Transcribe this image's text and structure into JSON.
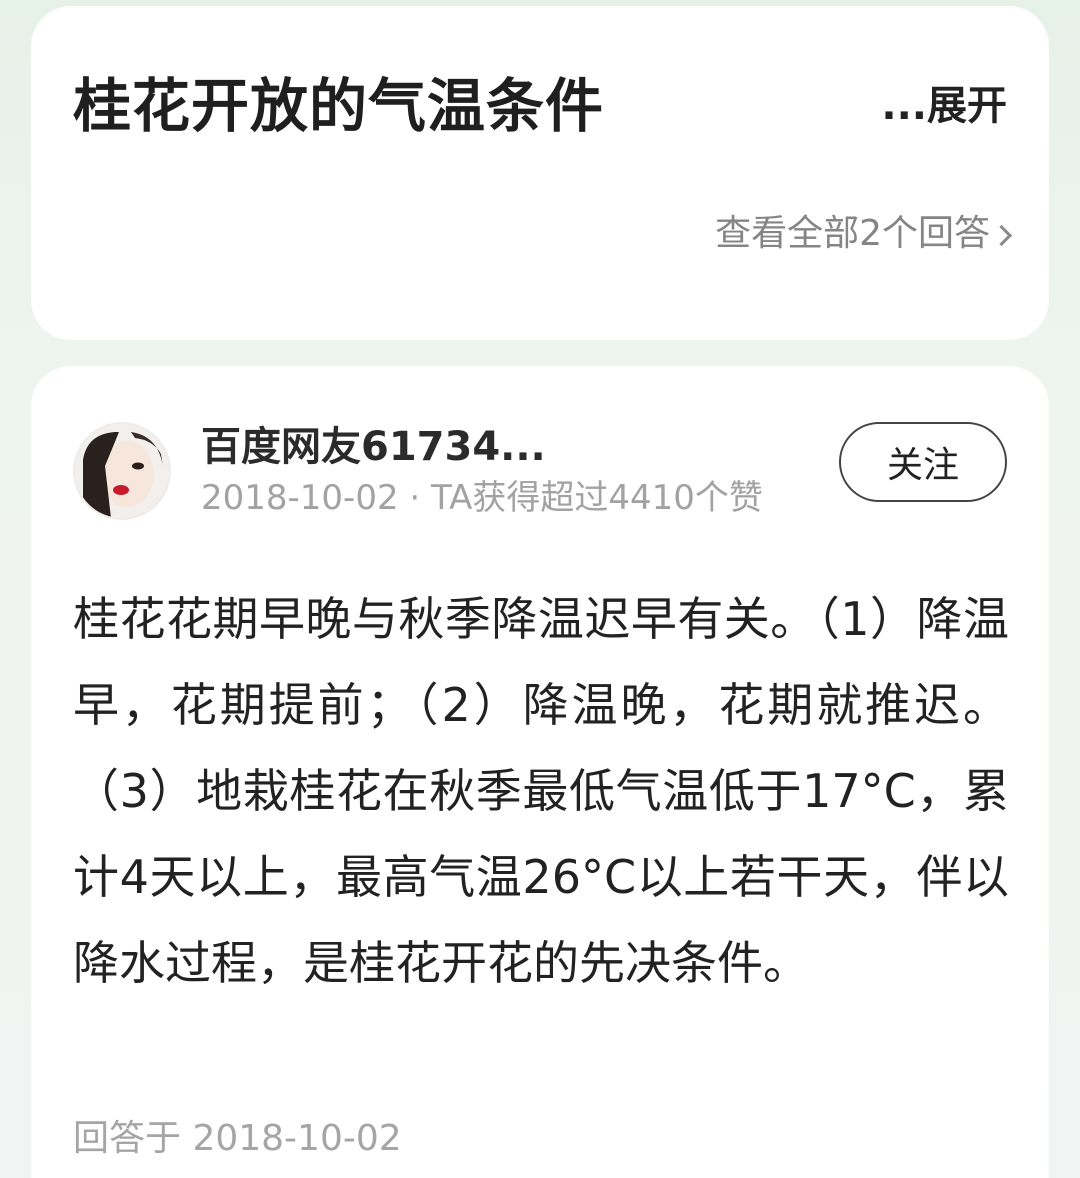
{
  "question": {
    "title": "桂花开放的气温条件",
    "expand_label": "...展开",
    "view_all_label": "查看全部2个回答"
  },
  "answer": {
    "author": {
      "name": "百度网友61734...",
      "meta": "2018-10-02 · TA获得超过4410个赞"
    },
    "follow_label": "关注",
    "body": "桂花花期早晚与秋季降温迟早有关。（1）降温早，花期提前；（2）降温晚，花期就推迟。（3）地栽桂花在秋季最低气温低于17°C，累计4天以上，最高气温26°C以上若干天，伴以降水过程，是桂花开花的先决条件。",
    "answered_at": "回答于 2018-10-02"
  }
}
